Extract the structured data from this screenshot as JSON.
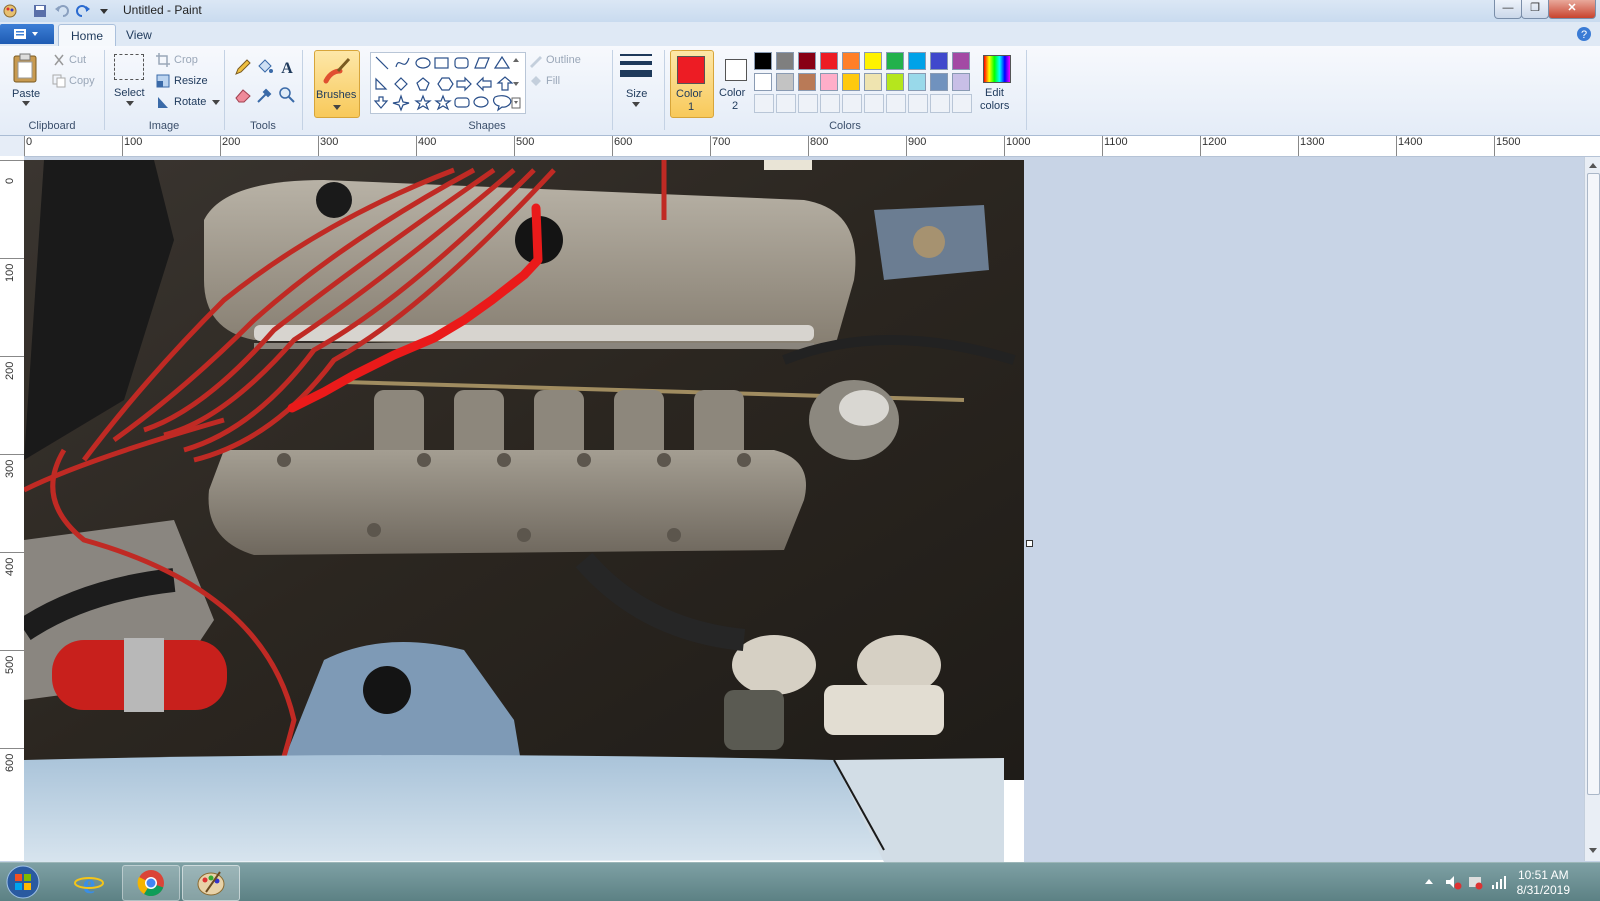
{
  "window": {
    "title": "Untitled - Paint"
  },
  "tabs": [
    {
      "label": "Home"
    },
    {
      "label": "View"
    }
  ],
  "clipboard": {
    "paste": "Paste",
    "cut": "Cut",
    "copy": "Copy",
    "group": "Clipboard"
  },
  "image": {
    "select": "Select",
    "crop": "Crop",
    "resize": "Resize",
    "rotate": "Rotate",
    "group": "Image"
  },
  "tools": {
    "group": "Tools"
  },
  "brushes": {
    "label": "Brushes"
  },
  "shapes": {
    "group": "Shapes",
    "outline": "Outline",
    "fill": "Fill"
  },
  "size": {
    "label": "Size"
  },
  "colors": {
    "color1_label": "Color",
    "color1_num": "1",
    "color1_value": "#ed1c24",
    "color2_label": "Color",
    "color2_num": "2",
    "color2_value": "#ffffff",
    "edit_label": "Edit",
    "edit_label2": "colors",
    "group": "Colors",
    "palette_row1": [
      "#000000",
      "#7f7f7f",
      "#880015",
      "#ed1c24",
      "#ff7f27",
      "#fff200",
      "#22b14c",
      "#00a2e8",
      "#3f48cc",
      "#a349a4"
    ],
    "palette_row2": [
      "#ffffff",
      "#c3c3c3",
      "#b97a57",
      "#ffaec9",
      "#ffc90e",
      "#efe4b0",
      "#b5e61d",
      "#99d9ea",
      "#7092be",
      "#c8bfe7"
    ]
  },
  "ruler": {
    "h": [
      "0",
      "100",
      "200",
      "300",
      "400",
      "500",
      "600",
      "700",
      "800",
      "900",
      "1000",
      "1100",
      "1200",
      "1300",
      "1400",
      "1500"
    ],
    "v": [
      "0",
      "100",
      "200",
      "300",
      "400",
      "500",
      "600"
    ]
  },
  "taskbar": {
    "time": "10:51 AM",
    "date": "8/31/2019"
  }
}
